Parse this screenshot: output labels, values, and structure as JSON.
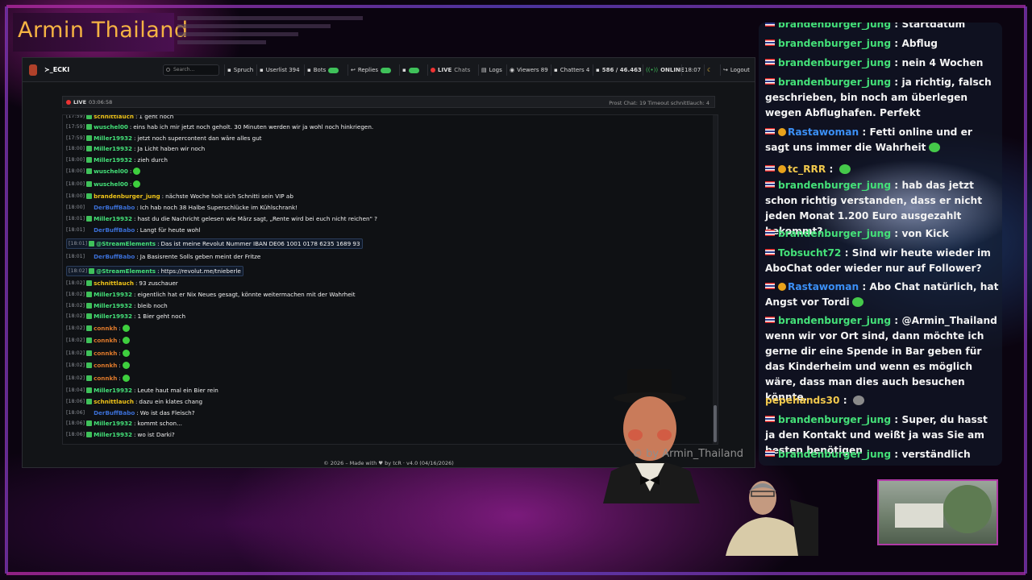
{
  "brand": {
    "title": "Armin Thailand"
  },
  "nav": {
    "site": "≻_ECKI",
    "search_placeholder": "Search...",
    "spruch": "Spruch",
    "userlist": "Userlist 394",
    "bots": "Bots",
    "replies": "Replies",
    "live": "LIVE",
    "chats": "Chats",
    "logs": "Logs",
    "viewers": "Viewers 89",
    "chatters": "Chatters 4",
    "messages": "586 / 46.463",
    "online": "ONLINE",
    "time": "18:07",
    "logout": "Logout"
  },
  "livebar": {
    "live": "LIVE",
    "uptime": "03:06:58",
    "right": "Prost Chat: 19  Timeout schnittlauch: 4"
  },
  "chat": [
    {
      "ts": "[17:59]",
      "user": "schnittlauch",
      "color": "#f0c419",
      "text": "1 geht noch"
    },
    {
      "ts": "[17:59]",
      "user": "wuschel00",
      "color": "#44e078",
      "text": "eins hab ich mir jetzt noch geholt. 30 Minuten werden wir ja wohl noch hinkriegen."
    },
    {
      "ts": "[17:59]",
      "user": "Miller19932",
      "color": "#44e078",
      "text": "jetzt noch supercontent dan wäre alles gut"
    },
    {
      "ts": "[18:00]",
      "user": "Miller19932",
      "color": "#44e078",
      "text": "Ja Licht haben wir noch"
    },
    {
      "ts": "[18:00]",
      "user": "Miller19932",
      "color": "#44e078",
      "text": "zieh durch"
    },
    {
      "ts": "[18:00]",
      "user": "wuschel00",
      "color": "#44e078",
      "text": ""
    },
    {
      "ts": "[18:00]",
      "user": "wuschel00",
      "color": "#44e078",
      "text": ""
    },
    {
      "ts": "[18:00]",
      "user": "brandenburger_jung",
      "color": "#f0c419",
      "text": "nächste Woche holt sich Schnitti sein VIP ab"
    },
    {
      "ts": "[18:00]",
      "user": "DerBuffBabo",
      "color": "#3b6fd6",
      "text": "Ich hab noch 38 Halbe Superschlücke im Kühlschrank!"
    },
    {
      "ts": "[18:01]",
      "user": "Miller19932",
      "color": "#44e078",
      "text": "hast du die Nachricht gelesen wie März sagt, „Rente wird bei euch nicht reichen\" ?"
    },
    {
      "ts": "[18:01]",
      "user": "DerBuffBabo",
      "color": "#3b6fd6",
      "text": "Langt für heute wohl"
    },
    {
      "ts": "[18:01]",
      "user": "@StreamElements",
      "color": "#44e078",
      "text": "Das ist meine Revolut Nummer IBAN DE06 1001 0178 6235 1689 93",
      "hl": true
    },
    {
      "ts": "[18:01]",
      "user": "DerBuffBabo",
      "color": "#3b6fd6",
      "text": "Ja Basisrente Solls geben meint der Fritze"
    },
    {
      "ts": "[18:02]",
      "user": "@StreamElements",
      "color": "#44e078",
      "text": "https://revolut.me/tnieberle",
      "hl": true
    },
    {
      "ts": "[18:02]",
      "user": "schnittlauch",
      "color": "#f0c419",
      "text": "93 zuschauer"
    },
    {
      "ts": "[18:02]",
      "user": "Miller19932",
      "color": "#44e078",
      "text": "eigentlich hat er Nix Neues gesagt, könnte weitermachen mit der Wahrheit"
    },
    {
      "ts": "[18:02]",
      "user": "Miller19932",
      "color": "#44e078",
      "text": "bleib noch"
    },
    {
      "ts": "[18:02]",
      "user": "Miller19932",
      "color": "#44e078",
      "text": "1 Bier geht noch"
    },
    {
      "ts": "[18:02]",
      "user": "connkh",
      "color": "#e07a2b",
      "text": ""
    },
    {
      "ts": "[18:02]",
      "user": "connkh",
      "color": "#e07a2b",
      "text": ""
    },
    {
      "ts": "[18:02]",
      "user": "connkh",
      "color": "#e07a2b",
      "text": ""
    },
    {
      "ts": "[18:02]",
      "user": "connkh",
      "color": "#e07a2b",
      "text": ""
    },
    {
      "ts": "[18:02]",
      "user": "connkh",
      "color": "#e07a2b",
      "text": ""
    },
    {
      "ts": "[18:04]",
      "user": "Miller19932",
      "color": "#44e078",
      "text": "Leute haut mal ein Bier rein"
    },
    {
      "ts": "[18:06]",
      "user": "schnittlauch",
      "color": "#f0c419",
      "text": "dazu ein klates chang"
    },
    {
      "ts": "[18:06]",
      "user": "DerBuffBabo",
      "color": "#3b6fd6",
      "text": "Wo ist das Fleisch?"
    },
    {
      "ts": "[18:06]",
      "user": "Miller19932",
      "color": "#44e078",
      "text": "kommt schon..."
    },
    {
      "ts": "[18:06]",
      "user": "Miller19932",
      "color": "#44e078",
      "text": "wo ist Darki?"
    }
  ],
  "footer": "© 2026 – Made with ♥ by tcR · v4.0 (04/16/2026)",
  "watermark": "© by Armin_Thailand",
  "overlay": [
    {
      "user": "brandenburger_jung",
      "text": "Startdatum"
    },
    {
      "user": "brandenburger_jung",
      "text": "Abflug"
    },
    {
      "user": "brandenburger_jung",
      "text": "nein 4 Wochen"
    },
    {
      "user": "brandenburger_jung",
      "text": "ja richtig, falsch geschrieben, bin noch am überlegen wegen Abflughafen. Perfekt"
    },
    {
      "user": "Rastawoman",
      "text": "Fetti online und er sagt uns immer die Wahrheit"
    },
    {
      "user": "tc_RRR",
      "text": ""
    },
    {
      "user": "brandenburger_jung",
      "text": "hab das jetzt schon richtig verstanden, dass er nicht jeden Monat 1.200 Euro ausgezahlt bekommt?"
    },
    {
      "user": "brandenburger_jung",
      "text": "von Kick"
    },
    {
      "user": "Tobsucht72",
      "text": "Sind wir heute wieder im AboChat oder wieder nur auf Follower?"
    },
    {
      "user": "Rastawoman",
      "text": "Abo Chat natürlich, hat Angst vor Tordi"
    },
    {
      "user": "brandenburger_jung",
      "text": "@Armin_Thailand wenn wir vor Ort sind, dann möchte ich gerne dir eine Spende in Bar geben für das Kinderheim und wenn es möglich wäre, dass man dies auch besuchen könnte."
    },
    {
      "user": "pepehands30",
      "text": ""
    },
    {
      "user": "brandenburger_jung",
      "text": "Super, du hasst ja den Kontakt und weißt ja was Sie am besten benötigen"
    },
    {
      "user": "brandenburger_jung",
      "text": "verständlich"
    }
  ],
  "colors": {
    "accent": "#b1289f",
    "green_user": "#44e078",
    "blue_user": "#3b8ff5",
    "gold": "#f5b343"
  }
}
